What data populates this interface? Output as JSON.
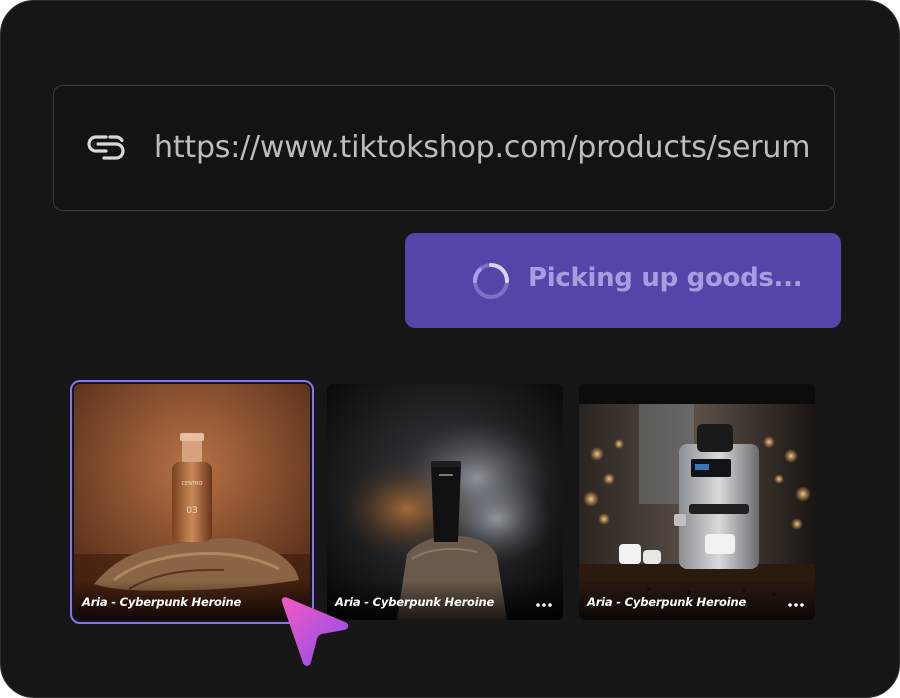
{
  "url_bar": {
    "icon": "link-icon",
    "value": "https://www.tiktokshop.com/products/serum"
  },
  "action_button": {
    "label": "Picking up goods...",
    "icon": "loading-spinner-icon",
    "color": "#5446a8"
  },
  "products": [
    {
      "caption": "Aria - Cyberpunk Heroine",
      "selected": true,
      "image": "perfume bottle on driftwood"
    },
    {
      "caption": "Aria - Cyberpunk Heroine",
      "selected": false,
      "image": "black tube on rock with smoke"
    },
    {
      "caption": "Aria - Cyberpunk Heroine",
      "selected": false,
      "image": "espresso machine with cups"
    }
  ],
  "accent_color": "#8a73f0"
}
